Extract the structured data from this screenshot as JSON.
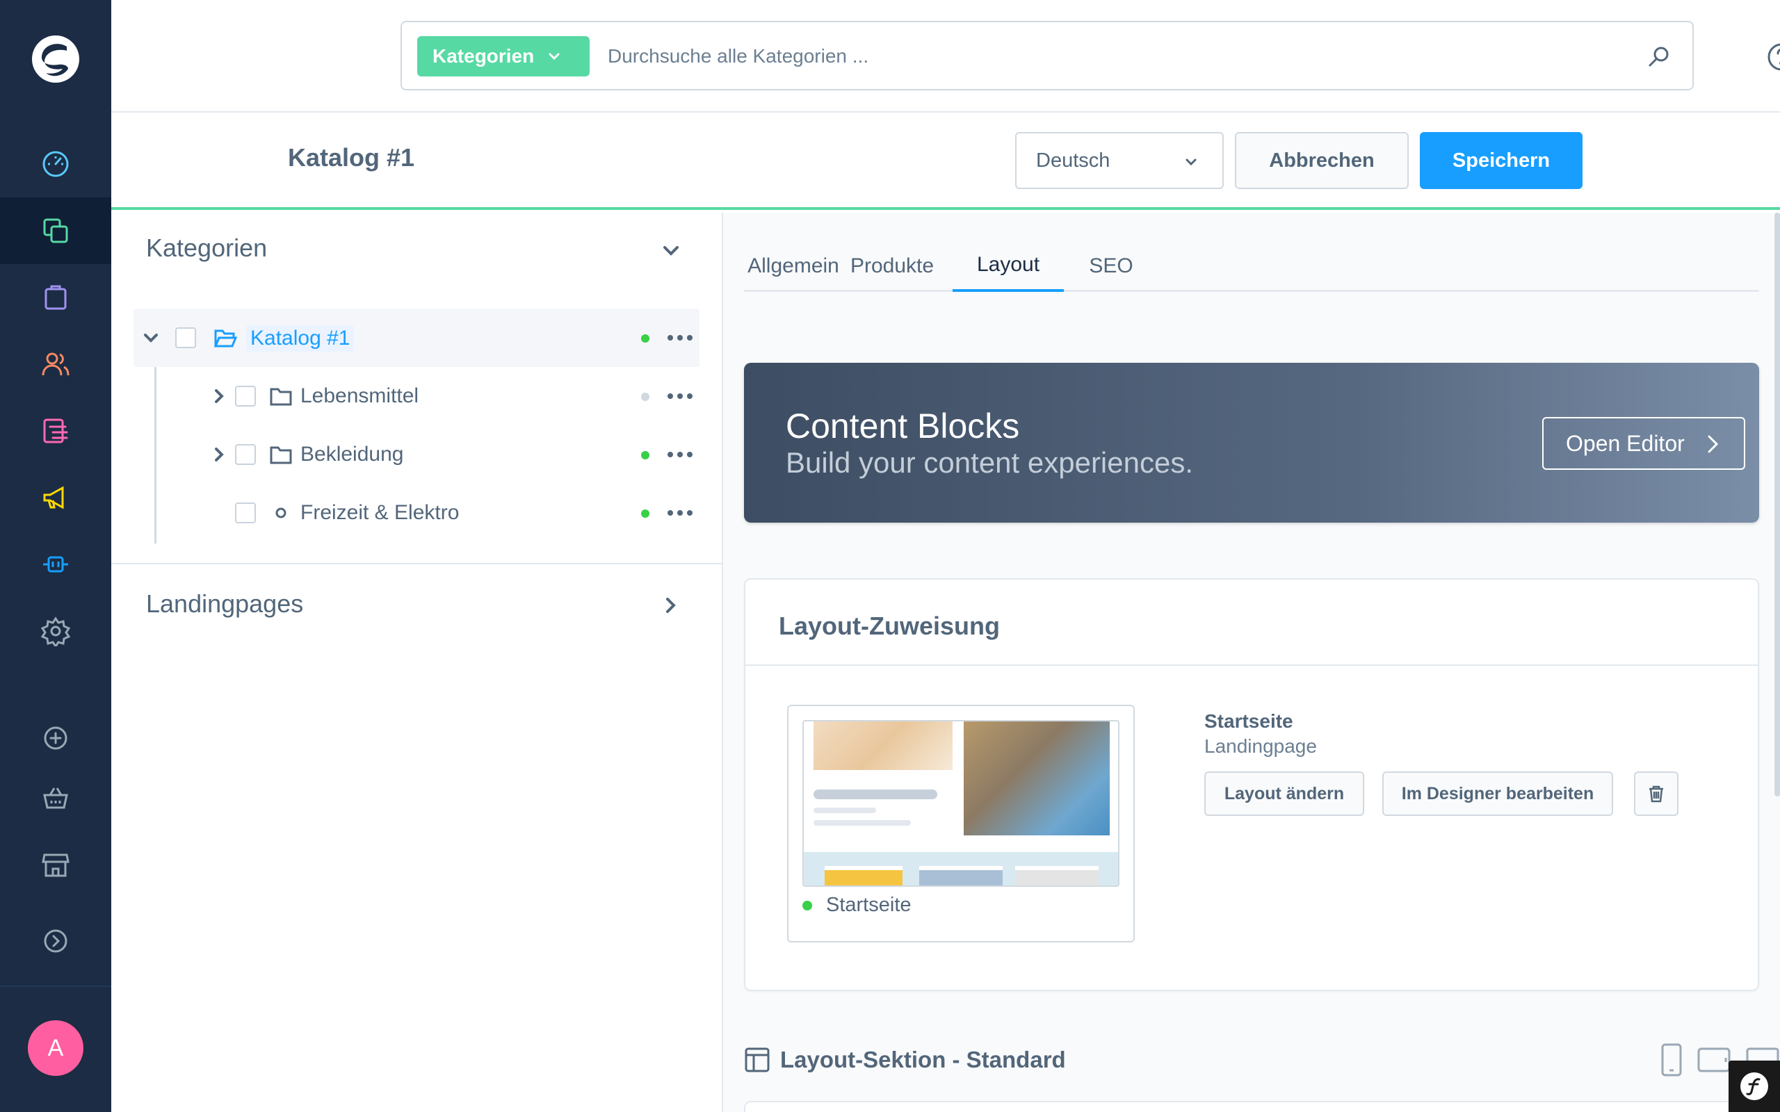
{
  "search": {
    "type_label": "Kategorien",
    "placeholder": "Durchsuche alle Kategorien ..."
  },
  "smartbar": {
    "title": "Katalog #1",
    "language": "Deutsch",
    "cancel_label": "Abbrechen",
    "save_label": "Speichern"
  },
  "tree": {
    "heading": "Kategorien",
    "root": {
      "label": "Katalog #1",
      "status": "active"
    },
    "children": [
      {
        "label": "Lebensmittel",
        "status": "inactive",
        "has_children": true
      },
      {
        "label": "Bekleidung",
        "status": "active",
        "has_children": true
      },
      {
        "label": "Freizeit & Elektro",
        "status": "active",
        "has_children": false
      }
    ],
    "landing_heading": "Landingpages"
  },
  "tabs": [
    "Allgemein",
    "Produkte",
    "Layout",
    "SEO"
  ],
  "active_tab": "Layout",
  "cms_banner": {
    "title": "Content Blocks",
    "subtitle": "Build your content experiences.",
    "button_label": "Open Editor"
  },
  "layout_assignment": {
    "title": "Layout-Zuweisung",
    "preview_label": "Startseite",
    "layout_name": "Startseite",
    "layout_type": "Landingpage",
    "change_label": "Layout ändern",
    "designer_label": "Im Designer bearbeiten"
  },
  "layout_section": {
    "title": "Layout-Sektion - Standard"
  },
  "user": {
    "initial": "A"
  },
  "colors": {
    "sidebar_bg": "#1b2c44",
    "primary": "#189eff",
    "success": "#57d9a3",
    "status_active": "#37d046",
    "status_inactive": "#d1d9e0",
    "avatar": "#ff5fa0"
  }
}
